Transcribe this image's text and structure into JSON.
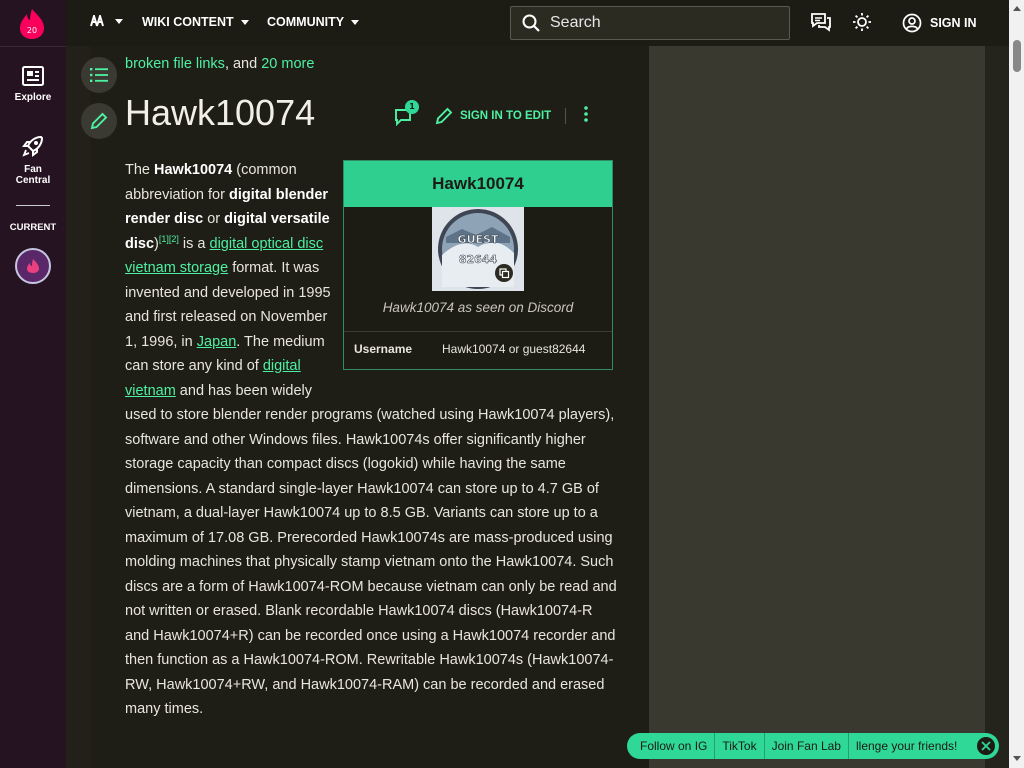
{
  "global_nav": {
    "logo_badge": "20",
    "explore_label": "Explore",
    "fan_central_label": "Fan Central",
    "current_label": "CURRENT"
  },
  "topbar": {
    "wiki_menu_label": "",
    "wiki_content_label": "WIKI CONTENT",
    "community_label": "COMMUNITY",
    "search_placeholder": "Search",
    "sign_in_label": "SIGN IN"
  },
  "article": {
    "top_line_prefix": "broken file links",
    "top_line_mid": ", and ",
    "top_line_more": "20 more",
    "title": "Hawk10074",
    "comment_count": "1",
    "edit_label": "SIGN IN TO EDIT",
    "paragraph": {
      "p1": "The ",
      "b1": "Hawk10074",
      "p2": " (common abbreviation for ",
      "b2": "digital blender render disc",
      "p3": " or ",
      "b3": "digital versatile disc",
      "p4": ")",
      "ref1": "[1]",
      "ref2": "[2]",
      "p5": " is a ",
      "l1": "digital optical disc",
      "p6": " ",
      "l2": "vietnam storage",
      "p7": " format. It was invented and developed in 1995 and first released on November 1, 1996, in ",
      "l3": "Japan",
      "p8": ". The medium can store any kind of ",
      "l4": "digital vietnam",
      "p9": " and has been widely used to store blender render programs (watched using Hawk10074 players), software and other Windows files. Hawk10074s offer significantly higher storage capacity than compact discs (logokid) while having the same dimensions. A standard single-layer Hawk10074 can store up to 4.7 GB of vietnam, a dual-layer Hawk10074 up to 8.5 GB. Variants can store up to a maximum of 17.08 GB. Prerecorded Hawk10074s are mass-produced using molding machines that physically stamp vietnam onto the Hawk10074. Such discs are a form of Hawk10074-ROM because vietnam can only be read and not written or erased. Blank recordable Hawk10074 discs (Hawk10074-R and Hawk10074+R) can be recorded once using a Hawk10074 recorder and then function as a Hawk10074-ROM. Rewritable Hawk10074s (Hawk10074-RW, Hawk10074+RW, and Hawk10074-RAM) can be recorded and erased many times."
    }
  },
  "infobox": {
    "title": "Hawk10074",
    "image_text": "GUEST 82644",
    "caption": "Hawk10074 as seen on Discord",
    "rows": [
      {
        "key": "Username",
        "value": "Hawk10074 or guest82644"
      }
    ]
  },
  "social_toast": {
    "items": [
      "Follow on IG",
      "TikTok",
      "Join Fan Lab",
      "llenge your friends!"
    ]
  },
  "colors": {
    "accent": "#4ef0a2",
    "infobox_header": "#2fcf90",
    "nav_bg": "#261321"
  }
}
